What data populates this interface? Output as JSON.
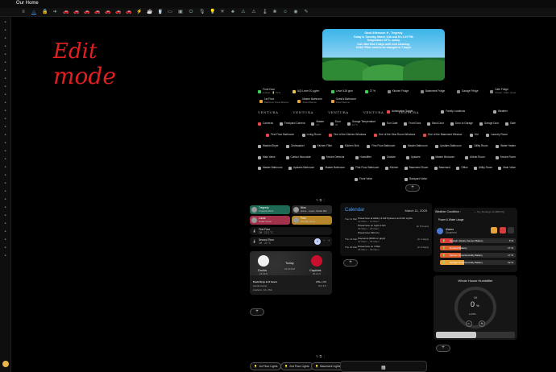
{
  "header": {
    "title": "Our Home"
  },
  "toolbar": {
    "icons": [
      "hamburger",
      "home",
      "lock",
      "arrow",
      "car",
      "car",
      "car",
      "car",
      "car",
      "car",
      "car",
      "bolt",
      "mug",
      "cup",
      "garage",
      "tv",
      "plug",
      "mic",
      "bulb",
      "sprinkler",
      "tree",
      "warning",
      "warning",
      "thermo",
      "plant",
      "person",
      "camera",
      "pencil"
    ]
  },
  "handwriting": {
    "line1": "Edit",
    "line2": "mode"
  },
  "weather": {
    "line1": "Good Afternoon ☀ , Tregredy",
    "line2": "Today is Tuesday, March 11th and It's 1:07 PM.",
    "line3": "Temperature 19°C, sunny.",
    "line4": "Cat Litter Box 3 days until next cleaning.",
    "line5": "HVAC Filter need to be changed in 7 days!"
  },
  "grid": {
    "row1": [
      {
        "label": "Front Door",
        "sub": "Locked · 🔋 75 %",
        "color": "#3ecf5a"
      },
      {
        "label": "AQI Level 10 µg/m³",
        "sub": "",
        "color": "#e8c84a"
      },
      {
        "label": "Level 418 ppm",
        "sub": "",
        "color": "#3ecf5a"
      },
      {
        "label": "27 %",
        "sub": "",
        "color": "#3ecf5a"
      },
      {
        "label": "Kitchen Fridge",
        "sub": "",
        "color": "#888"
      },
      {
        "label": "Basement Fridge",
        "sub": "",
        "color": "#888"
      },
      {
        "label": "Garage Fridge",
        "sub": "",
        "color": "#888"
      },
      {
        "label": "Cafe Fridge",
        "sub": "Closed · Filter: Good",
        "color": "#888"
      }
    ],
    "row2": [
      {
        "label": "1st Floor",
        "sub": "Bathroom Towel Warmer",
        "color": "#e8a33a"
      },
      {
        "label": "Master Bathroom",
        "sub": "Towel Warmer",
        "color": "#e8a33a"
      },
      {
        "label": "Guest's Bathroom",
        "sub": "Towel Warmer",
        "color": "#e8a33a"
      }
    ],
    "row3": [
      "VENTURA",
      "VENTURA",
      "VENTURA",
      "VENTURA",
      "VENTURA"
    ],
    "row3b": [
      {
        "label": "Automation Toggle",
        "sub": "",
        "color": "#e8484a"
      },
      {
        "label": "Family Locations",
        "sub": "",
        "color": "#aaa"
      },
      {
        "label": "Weather",
        "sub": "",
        "color": "#aaa"
      }
    ],
    "row4": [
      {
        "label": "Cameras",
        "sub": "",
        "color": "#e8484a"
      },
      {
        "label": "Frontyard Camera",
        "sub": "",
        "color": "#aaa"
      },
      {
        "label": "Master",
        "sub": "off",
        "color": "#aaa"
      },
      {
        "label": "Door",
        "sub": "off",
        "color": "#aaa"
      },
      {
        "label": "Garage Temperature",
        "sub": "14 °C",
        "color": "#aaa"
      },
      {
        "label": "Sun Gate",
        "sub": "",
        "color": "#aaa"
      },
      {
        "label": "Front Door",
        "sub": "",
        "color": "#aaa"
      },
      {
        "label": "Back Door",
        "sub": "",
        "color": "#aaa"
      },
      {
        "label": "Door to Garage",
        "sub": "",
        "color": "#aaa"
      },
      {
        "label": "Garage Door",
        "sub": "",
        "color": "#aaa"
      },
      {
        "label": "Gate",
        "sub": "",
        "color": "#aaa"
      }
    ],
    "row5": [
      {
        "label": "First Floor Bathroom",
        "color": "#e8484a"
      },
      {
        "label": "Living Room",
        "color": "#aaa"
      },
      {
        "label": "One of the Kitchen Windows",
        "color": "#e8484a"
      },
      {
        "label": "One of the Dine Room Windows",
        "color": "#e8484a"
      },
      {
        "label": "One of the Basement Window",
        "color": "#e8484a"
      },
      {
        "label": "Kid",
        "color": "#aaa"
      },
      {
        "label": "Laundry Room",
        "color": "#aaa"
      }
    ],
    "row6": [
      "Washer/Dryer",
      "Dishwasher",
      "Kitchen Filter",
      "Kitchen Sink",
      "First Floor Bathroom",
      "Master Bathroom",
      "Upstairs Bathroom",
      "Utility Room",
      "Water Heater"
    ],
    "row7": [
      "Main Valve",
      "Carbon Monoxide",
      "Smoke Detector",
      "Humidifier",
      "Outside",
      "Upstairs",
      "Master Bedroom",
      "Airbnb Room",
      "Smoke Room"
    ],
    "row8": [
      "Master Bathroom",
      "Upstairs Bathroom",
      "Master Bathroom",
      "First Floor Bathroom",
      "Kitchen",
      "Basement Room",
      "Basement",
      "Office",
      "Utility Room",
      "Main Valve"
    ],
    "row9": [
      "Front Valve",
      "Backyard Valve"
    ]
  },
  "people": [
    {
      "name": "Tregredy",
      "sub": "Tregredy Work",
      "color": "#1e6a55"
    },
    {
      "name": "Nina",
      "sub": "Home · Lopez, Studio Mid",
      "color": "#2a2a2a"
    },
    {
      "name": "Lucas",
      "sub": "Guitar Home",
      "color": "#a3314a"
    },
    {
      "name": "Pam",
      "sub": "Friendly Home",
      "color": "#b8862a"
    }
  ],
  "first_floor": {
    "title": "First Floor",
    "sub": "Off · 22.1 °C"
  },
  "second_floor": {
    "title": "Second Floor",
    "sub": "Off · 22 °C",
    "value": "0"
  },
  "game": {
    "team1": "Ducks",
    "team2": "Capitals",
    "when": "Today",
    "time": "10:00 PM",
    "record1": "23-31-8",
    "record2": "40-14-8",
    "note": "Puck Drop in 8 hours",
    "venue": "Honda Center",
    "city": "Anaheim, CA, USA",
    "odds1": "WSH -170",
    "odds2": "O/U 6.5",
    "odds3": ""
  },
  "calendar": {
    "title": "Calendar",
    "date": "March 11, 2025",
    "events": [
      {
        "day": "Tue 11 Mar",
        "title": "Powerzone at Hillary & Hill Systems and Girl Lights",
        "time": "12:00am – 11:00am",
        "right": ""
      },
      {
        "day": "",
        "title": "Powerzone on Light 4 A/C",
        "time": "08:00am – 08:00am",
        "right": "(in 5 hours)"
      },
      {
        "day": "",
        "title": "Powerzone 190 min",
        "time": "",
        "right": ""
      },
      {
        "day": "Thu 13 Mar",
        "title": "Payments (€100 on guys)",
        "time": "03:00am – 06:00am",
        "right": "(in 2 days)"
      },
      {
        "day": "Thu 20 Mar",
        "title": "Powerzone on 4 filter",
        "time": "05:00pm – 06:00pm",
        "right": "(in 9 days)"
      }
    ]
  },
  "weather_cond": {
    "title": "Weather Condition :",
    "sub": "— Toy, Durango 12 dBM NQ"
  },
  "power": {
    "title": "Power & Water Usage",
    "alarm": "Alarmo",
    "alarm_sub": "Disarmed"
  },
  "batteries": [
    {
      "label": "Upstairs Motion Sensor Battery",
      "pct": "5 %",
      "color": "#d63c3c",
      "fill": 5
    },
    {
      "label": "Doorbell Battery",
      "pct": "17 %",
      "color": "#e06030",
      "fill": 17
    },
    {
      "label": "Kitchen Temp/Humidity Battery",
      "pct": "17 %",
      "color": "#e06030",
      "fill": 17
    },
    {
      "label": "Garage Temp/Humidity Battery",
      "pct": "22 %",
      "color": "#e8a33a",
      "fill": 22
    }
  ],
  "humidifier": {
    "title": "Whole House Humidifier",
    "state": "Off",
    "value": "0",
    "unit": "%",
    "sub": "● 45%"
  },
  "bottom": [
    {
      "label": "1st Floor Lights"
    },
    {
      "label": "2nd Floor Lights"
    },
    {
      "label": "Basement Lights"
    }
  ]
}
